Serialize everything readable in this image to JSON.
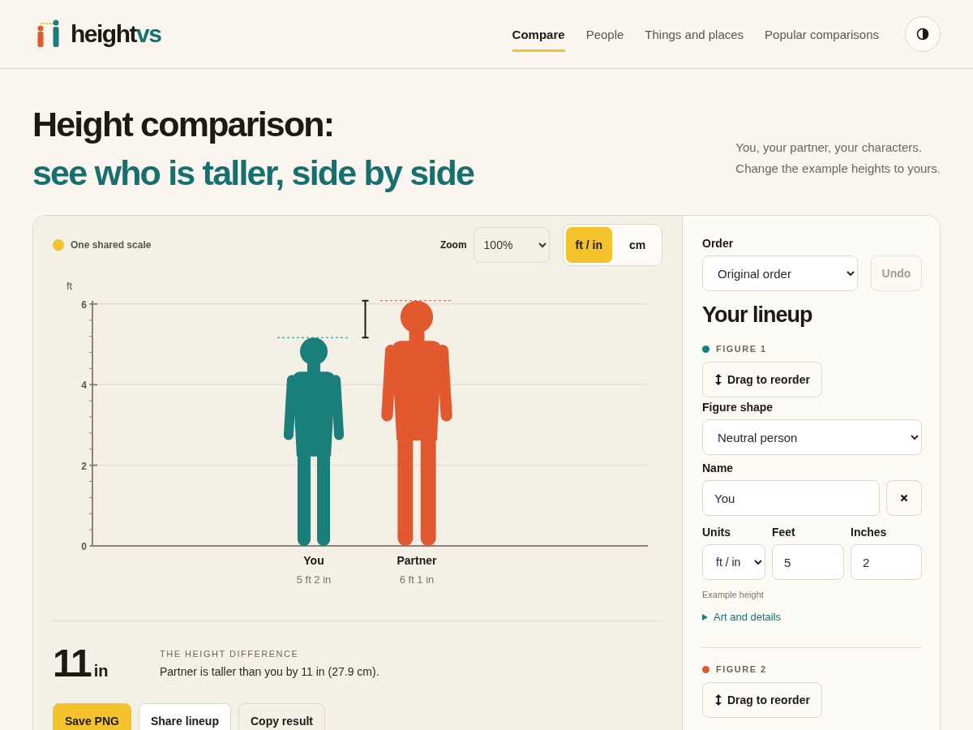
{
  "header": {
    "logo": {
      "text": "height",
      "accent": "vs"
    },
    "nav": [
      {
        "label": "Compare",
        "selected": true
      },
      {
        "label": "People",
        "selected": false
      },
      {
        "label": "Things and places",
        "selected": false
      },
      {
        "label": "Popular comparisons",
        "selected": false
      }
    ]
  },
  "hero": {
    "title": "Height comparison:",
    "subtitle": "see who is taller, side by side",
    "tagline": [
      "You, your partner, your characters.",
      "Change the example heights to yours."
    ]
  },
  "chart_panel": {
    "scale_label": "One shared scale",
    "zoom_label": "Zoom",
    "zoom_value": "100%",
    "units": [
      {
        "label": "ft / in",
        "selected": true
      },
      {
        "label": "cm",
        "selected": false
      }
    ],
    "axis_unit": "ft",
    "yticks": [
      "6",
      "4",
      "2",
      "0"
    ],
    "figures": [
      {
        "name": "You",
        "height": "5 ft 2 in",
        "color": "#1a7f7b"
      },
      {
        "name": "Partner",
        "height": "6 ft 1 in",
        "color": "#e2582f"
      }
    ]
  },
  "difference": {
    "value": "11",
    "unit": "in",
    "label": "THE HEIGHT DIFFERENCE",
    "text": "Partner is taller than you by 11 in (27.9 cm)."
  },
  "actions": [
    {
      "label": "Save PNG",
      "kind": "primary"
    },
    {
      "label": "Share lineup",
      "kind": "secondary"
    },
    {
      "label": "Copy result",
      "kind": "tertiary"
    }
  ],
  "sidebar": {
    "order_label": "Order",
    "order_value": "Original order",
    "undo": {
      "label": "Undo",
      "disabled": true
    },
    "heading": "Your lineup",
    "figures": [
      {
        "label": "FIGURE 1",
        "color": "#1a7f7b",
        "drag": "Drag to reorder",
        "shape_label": "Figure shape",
        "shape_value": "Neutral person",
        "name_label": "Name",
        "name_value": "You",
        "units_label": "Units",
        "units_value": "ft / in",
        "feet_label": "Feet",
        "feet_value": "5",
        "inches_label": "Inches",
        "inches_value": "2",
        "hint": "Example height",
        "details": "Art and details"
      },
      {
        "label": "FIGURE 2",
        "color": "#e2582f",
        "drag": "Drag to reorder"
      }
    ]
  }
}
